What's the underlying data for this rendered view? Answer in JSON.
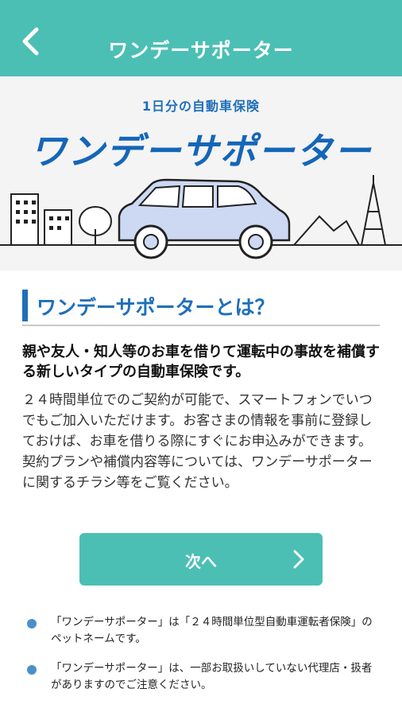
{
  "header": {
    "title": "ワンデーサポーター",
    "back_icon": "chevron-left-icon"
  },
  "hero": {
    "subtitle": "1日分の自動車保険",
    "logo_text": "ワンデーサポーター"
  },
  "section": {
    "heading": "ワンデーサポーターとは？",
    "lead": "親や友人・知人等のお車を借りて運転中の事故を補償する新しいタイプの自動車保険です。",
    "body": "２４時間単位でのご契約が可能で、スマートフォンでいつでもご加入いただけます。お客さまの情報を事前に登録しておけば、お車を借りる際にすぐにお申込みができます。契約プランや補償内容等については、ワンデーサポーターに関するチラシ等をご覧ください。"
  },
  "next_button": {
    "label": "次へ",
    "icon": "chevron-right-icon"
  },
  "notes": [
    "「ワンデーサポーター」は「２４時間単位型自動車運転者保険」のペットネームです。",
    "「ワンデーサポーター」は、一部お取扱いしていない代理店・扱者がありますのでご注意ください。"
  ],
  "colors": {
    "header_bg": "#4bbfb4",
    "brand_blue": "#1f6fba",
    "button_bg": "#4bbfb4",
    "bullet": "#4a90c8"
  }
}
